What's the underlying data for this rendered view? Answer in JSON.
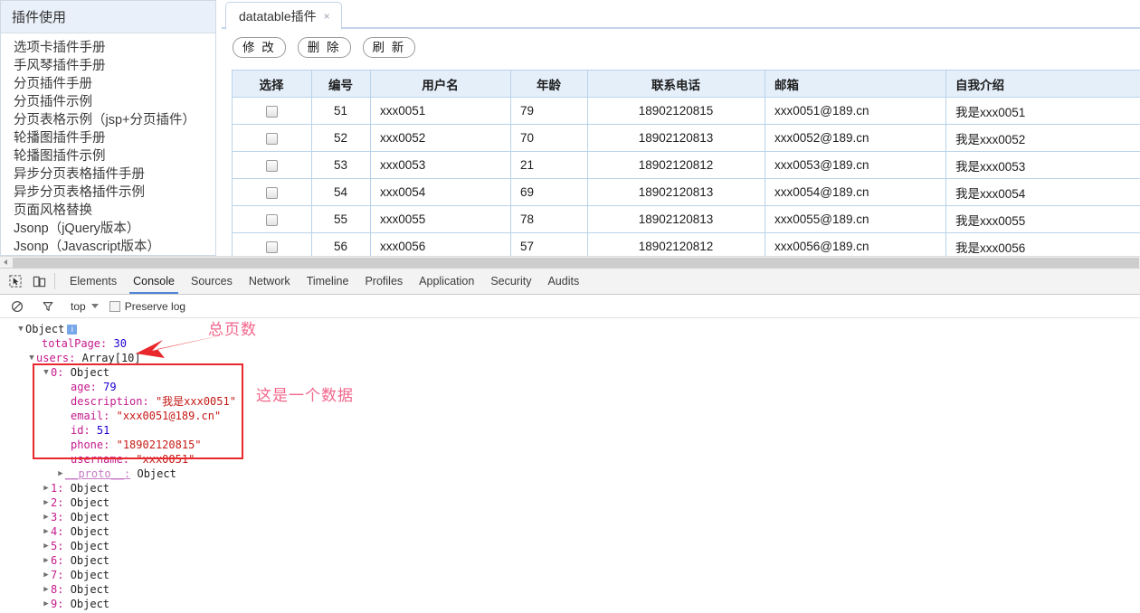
{
  "sidebar": {
    "header": "插件使用",
    "items": [
      "选项卡插件手册",
      "手风琴插件手册",
      "分页插件手册",
      "分页插件示例",
      "分页表格示例（jsp+分页插件）",
      "轮播图插件手册",
      "轮播图插件示例",
      "异步分页表格插件手册",
      "异步分页表格插件示例",
      "页面风格替换",
      "Jsonp（jQuery版本）",
      "Jsonp（Javascript版本）"
    ]
  },
  "tab": {
    "label": "datatable插件",
    "close": "×"
  },
  "toolbar": {
    "edit_label": "修 改",
    "delete_label": "删 除",
    "refresh_label": "刷 新"
  },
  "table": {
    "headers": [
      "选择",
      "编号",
      "用户名",
      "年龄",
      "联系电话",
      "邮箱",
      "自我介绍"
    ],
    "rows": [
      {
        "id": "51",
        "username": "xxx0051",
        "age": "79",
        "phone": "18902120815",
        "email": "xxx0051@189.cn",
        "desc": "我是xxx0051"
      },
      {
        "id": "52",
        "username": "xxx0052",
        "age": "70",
        "phone": "18902120813",
        "email": "xxx0052@189.cn",
        "desc": "我是xxx0052"
      },
      {
        "id": "53",
        "username": "xxx0053",
        "age": "21",
        "phone": "18902120812",
        "email": "xxx0053@189.cn",
        "desc": "我是xxx0053"
      },
      {
        "id": "54",
        "username": "xxx0054",
        "age": "69",
        "phone": "18902120813",
        "email": "xxx0054@189.cn",
        "desc": "我是xxx0054"
      },
      {
        "id": "55",
        "username": "xxx0055",
        "age": "78",
        "phone": "18902120813",
        "email": "xxx0055@189.cn",
        "desc": "我是xxx0055"
      },
      {
        "id": "56",
        "username": "xxx0056",
        "age": "57",
        "phone": "18902120812",
        "email": "xxx0056@189.cn",
        "desc": "我是xxx0056"
      }
    ]
  },
  "devtools": {
    "tabs": [
      "Elements",
      "Console",
      "Sources",
      "Network",
      "Timeline",
      "Profiles",
      "Application",
      "Security",
      "Audits"
    ],
    "active_tab": "Console",
    "context": "top",
    "preserve_log": "Preserve log",
    "icons": {
      "inspect": "inspect-element-icon",
      "device": "device-toolbar-icon",
      "clear": "clear-console-icon",
      "filter": "filter-icon"
    }
  },
  "console": {
    "root_label": "Object",
    "root_badge": "i",
    "total_page_key": "totalPage:",
    "total_page_value": "30",
    "users_key": "users:",
    "users_value": "Array[10]",
    "item0_index": "0:",
    "item0_type": "Object",
    "item0_props": [
      {
        "key": "age:",
        "value": "79",
        "type": "num"
      },
      {
        "key": "description:",
        "value": "\"我是xxx0051\"",
        "type": "str"
      },
      {
        "key": "email:",
        "value": "\"xxx0051@189.cn\"",
        "type": "str"
      },
      {
        "key": "id:",
        "value": "51",
        "type": "num"
      },
      {
        "key": "phone:",
        "value": "\"18902120815\"",
        "type": "str"
      },
      {
        "key": "username:",
        "value": "\"xxx0051\"",
        "type": "str"
      }
    ],
    "proto_key": "__proto__:",
    "proto_value": "Object",
    "siblings": [
      {
        "index": "1:",
        "value": "Object"
      },
      {
        "index": "2:",
        "value": "Object"
      },
      {
        "index": "3:",
        "value": "Object"
      },
      {
        "index": "4:",
        "value": "Object"
      },
      {
        "index": "5:",
        "value": "Object"
      },
      {
        "index": "6:",
        "value": "Object"
      },
      {
        "index": "7:",
        "value": "Object"
      },
      {
        "index": "8:",
        "value": "Object"
      },
      {
        "index": "9:",
        "value": "Object"
      }
    ]
  },
  "annotations": {
    "total_page_note": "总页数",
    "one_record_note": "这是一个数据",
    "arrow_color": "#e8282d",
    "box_color": "#e8282d",
    "text_color": "#f2668c"
  }
}
